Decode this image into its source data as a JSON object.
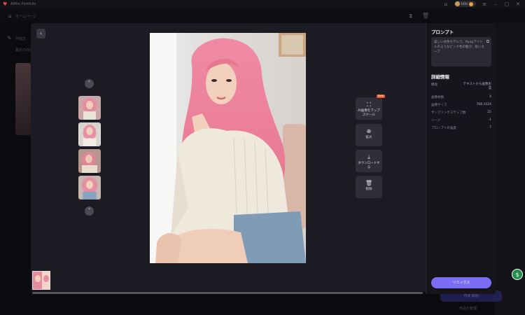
{
  "titlebar": {
    "app_name": "AIPho Portfolio",
    "user_name": "Iolo"
  },
  "header": {
    "home_label": "ホームページ"
  },
  "background": {
    "section_title": "作成文",
    "section_sub": "最近の作品",
    "remix_btn": "作成 開始",
    "small_text": "作品の管理"
  },
  "modal": {
    "tools": [
      {
        "label": "AI画像をアップスケール",
        "icon": "upscale-icon",
        "beta": "Beta"
      },
      {
        "label": "拡大",
        "icon": "zoom-icon"
      },
      {
        "label": "ダウンロードする",
        "icon": "download-icon"
      },
      {
        "label": "削除",
        "icon": "trash-icon"
      }
    ],
    "side": {
      "prompt_title": "プロンプト",
      "prompt_text": "美しい女性モデルで、Kpopアイドルのようなピンク色の髪が、長いカーブ",
      "details_title": "詳細情報",
      "details": [
        {
          "label": "機能",
          "value": "テキストから画像生成"
        },
        {
          "label": "画像枚数",
          "value": "4"
        },
        {
          "label": "画像サイズ",
          "value": "768,1024"
        },
        {
          "label": "サンプリングステップ数",
          "value": "25"
        },
        {
          "label": "シード",
          "value": "-1"
        },
        {
          "label": "プロンプトの強度",
          "value": "7"
        }
      ],
      "remix_label": "リミックス"
    }
  },
  "colors": {
    "accent": "#7c6cf4",
    "modal_bg": "#1c1b24",
    "beta_badge": "#e85a2a"
  }
}
